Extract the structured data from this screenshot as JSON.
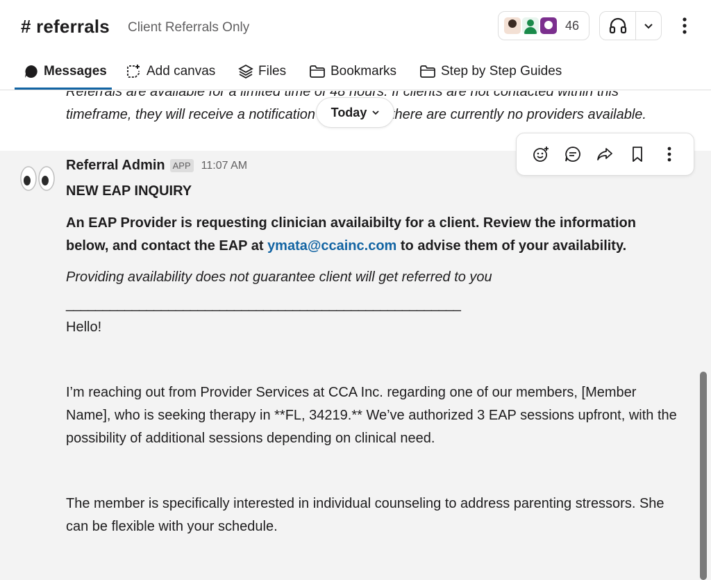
{
  "header": {
    "channel_name": "# referrals",
    "channel_topic": "Client Referrals Only",
    "member_count": "46"
  },
  "tabs": [
    {
      "label": "Messages",
      "icon": "message-bubble-icon",
      "active": true
    },
    {
      "label": "Add canvas",
      "icon": "add-canvas-icon",
      "active": false
    },
    {
      "label": "Files",
      "icon": "files-stack-icon",
      "active": false
    },
    {
      "label": "Bookmarks",
      "icon": "folder-icon",
      "active": false
    },
    {
      "label": "Step by Step Guides",
      "icon": "folder-icon",
      "active": false
    }
  ],
  "previous_message": {
    "text": "Referrals are available for a limited time of 48 hours. If clients are not contacted within this timeframe, they will receive a notification stating that there are currently no providers available."
  },
  "date_divider": {
    "label": "Today"
  },
  "message": {
    "sender": "Referral Admin",
    "badge": "APP",
    "time": "11:07 AM",
    "heading": "NEW EAP INQUIRY",
    "intro_before": "An EAP Provider is requesting clinician availaibilty for a client. Review the information below, and contact the EAP at ",
    "email": "ymata@ccainc.com",
    "intro_after": " to advise them of your availability.",
    "disclaimer": "Providing availability does not guarantee client will get referred to you",
    "divider": "______________________________________________________",
    "greeting": "Hello!",
    "para1": "I’m reaching out from Provider Services at CCA Inc. regarding one of our members, [Member Name], who is seeking therapy in **FL, 34219.**  We’ve authorized 3 EAP sessions upfront, with the possibility of additional sessions depending on clinical need.",
    "para2": "The member is specifically interested in individual counseling to address parenting stressors. She can be flexible with your schedule."
  },
  "message_actions": [
    "add-reaction-icon",
    "reply-thread-icon",
    "share-forward-icon",
    "bookmark-icon",
    "more-actions-icon"
  ],
  "colors": {
    "link": "#1264a3",
    "active_tab_underline": "#1264a3",
    "message_bg": "#f3f3f3"
  }
}
